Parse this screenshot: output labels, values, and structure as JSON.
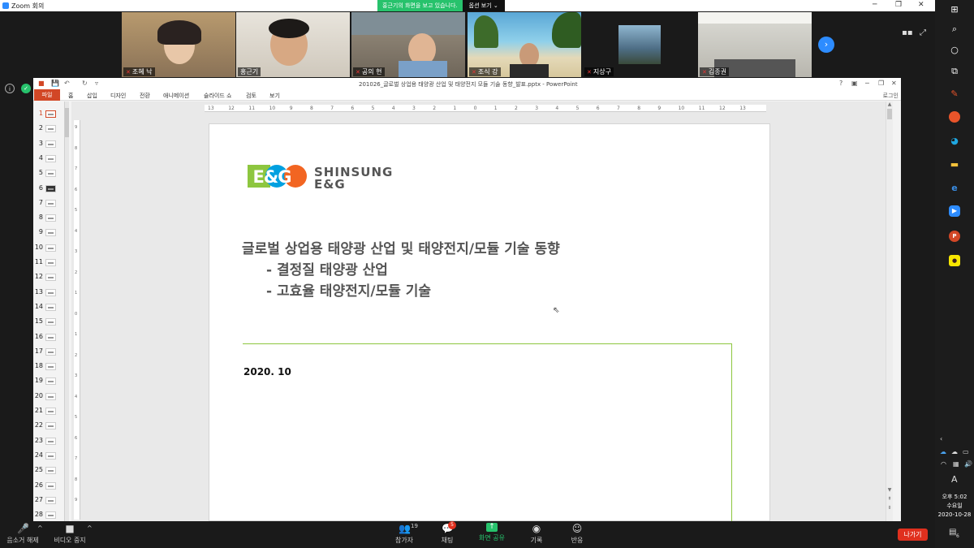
{
  "zoom": {
    "window_title": "Zoom 회의",
    "share_banner": "홍근기의 화면을 보고 있습니다.",
    "view_options": "옵션 보기 ⌄",
    "participants": [
      {
        "name": "조혜 낙",
        "muted": true
      },
      {
        "name": "홍근기",
        "muted": false
      },
      {
        "name": "공의 현",
        "muted": true
      },
      {
        "name": "조식 강",
        "muted": true
      },
      {
        "name": "지상구",
        "muted": true
      },
      {
        "name": "김종권",
        "muted": true
      }
    ],
    "toolbar": {
      "mute_label": "음소거 해제",
      "video_label": "비디오 중지",
      "participants_label": "참가자",
      "participants_count": "19",
      "chat_label": "채팅",
      "chat_badge": "5",
      "share_label": "화면 공유",
      "record_label": "기록",
      "reactions_label": "반응",
      "leave_label": "나가기"
    },
    "colors": {
      "accent": "#2d8cff",
      "share_green": "#27c26c",
      "leave_red": "#e0301e"
    }
  },
  "ppt": {
    "document_title": "201026_글로벌 상업용 태양광 산업 및 태양전지 모듈 기술 동향_발표.pptx - PowerPoint",
    "help": "?",
    "signin": "로그인",
    "tabs": [
      "파일",
      "홈",
      "삽입",
      "디자인",
      "전환",
      "애니메이션",
      "슬라이드 쇼",
      "검토",
      "보기"
    ],
    "slide_numbers": [
      "1",
      "2",
      "3",
      "4",
      "5",
      "6",
      "7",
      "8",
      "9",
      "10",
      "11",
      "12",
      "13",
      "14",
      "15",
      "16",
      "17",
      "18",
      "19",
      "20",
      "21",
      "22",
      "23",
      "24",
      "25",
      "26",
      "27",
      "28"
    ],
    "ruler_ticks": [
      "13",
      "12",
      "11",
      "10",
      "9",
      "8",
      "7",
      "6",
      "5",
      "4",
      "3",
      "2",
      "1",
      "0",
      "1",
      "2",
      "3",
      "4",
      "5",
      "6",
      "7",
      "8",
      "9",
      "10",
      "11",
      "12",
      "13"
    ],
    "vruler_ticks": [
      "9",
      "8",
      "7",
      "6",
      "5",
      "4",
      "3",
      "2",
      "1",
      "0",
      "1",
      "2",
      "3",
      "4",
      "5",
      "6",
      "7",
      "8",
      "9"
    ],
    "slide": {
      "logo_text_1": "SHINSUNG",
      "logo_text_2": "E&G",
      "logo_mark": "E&G",
      "title": "글로벌 상업용 태양광 산업 및 태양전지/모듈 기술 동향",
      "bullet_1": "- 결정질 태양광 산업",
      "bullet_2": "- 고효율 태양전지/모듈 기술",
      "date": "2020. 10"
    },
    "colors": {
      "file_tab": "#d24726",
      "brand_green": "#8dc63f",
      "brand_blue": "#00a0e0",
      "brand_orange": "#f26522"
    }
  },
  "taskbar": {
    "ime": "A",
    "time": "오후 5:02",
    "weekday": "수요일",
    "date": "2020-10-28",
    "notifications": "6"
  }
}
